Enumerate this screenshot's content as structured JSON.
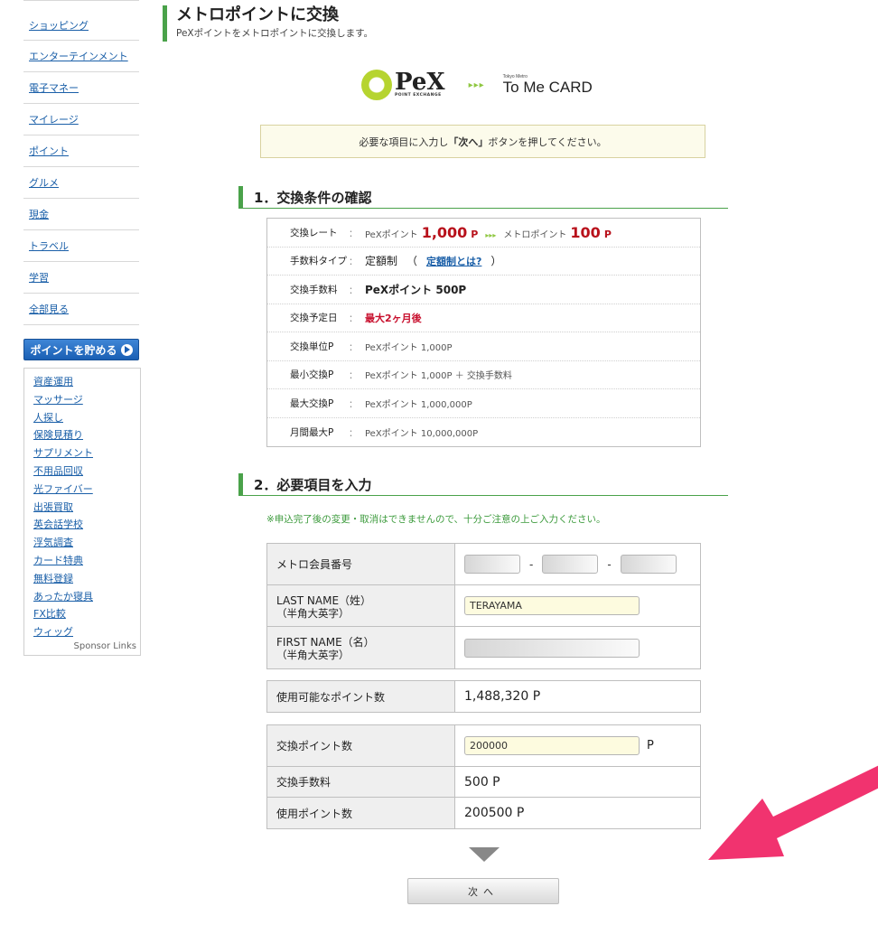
{
  "sidebar": {
    "categories": [
      "ショッピング",
      "エンターテインメント",
      "電子マネー",
      "マイレージ",
      "ポイント",
      "グルメ",
      "現金",
      "トラベル",
      "学習",
      "全部見る"
    ],
    "save_button_label": "ポイントを貯める",
    "sponsor_links": [
      "資産運用",
      "マッサージ",
      "人探し",
      "保険見積り",
      "サプリメント",
      "不用品回収",
      "光ファイバー",
      "出張買取",
      "英会話学校",
      "浮気調査",
      "カード特典",
      "無料登録",
      "あったか寝具",
      "FX比較",
      "ウィッグ"
    ],
    "sponsor_label": "Sponsor Links"
  },
  "header": {
    "title": "メトロポイントに交換",
    "subtitle": "PeXポイントをメトロポイントに交換します。"
  },
  "logos": {
    "pex_text": "PeX",
    "pex_small": "POINT EXCHANGE",
    "arrows": "▸▸▸",
    "tome_top": "Tokyo Metro",
    "tome_main": "To Me CARD"
  },
  "notice": {
    "before": "必要な項目に入力し",
    "emphasis": "「次へ」",
    "after": "ボタンを押してください。"
  },
  "section1": {
    "title": "1．交換条件の確認",
    "colon": "：",
    "rate": {
      "label": "交換レート",
      "pex_label": "PeXポイント",
      "pex_amount": "1,000",
      "pex_unit": "P",
      "arrows": "▸▸▸",
      "metro_label": "メトロポイント",
      "metro_amount": "100",
      "metro_unit": "P"
    },
    "fee_type": {
      "label": "手数料タイプ",
      "value": "定額制",
      "open_paren": "（",
      "link": "定額制とは?",
      "close_paren": "）"
    },
    "fee": {
      "label": "交換手数料",
      "value": "PeXポイント 500P"
    },
    "schedule": {
      "label": "交換予定日",
      "value": "最大2ヶ月後"
    },
    "unit": {
      "label": "交換単位P",
      "value": "PeXポイント 1,000P"
    },
    "min": {
      "label": "最小交換P",
      "value": "PeXポイント 1,000P ＋ 交換手数料"
    },
    "max": {
      "label": "最大交換P",
      "value": "PeXポイント 1,000,000P"
    },
    "monthly": {
      "label": "月間最大P",
      "value": "PeXポイント 10,000,000P"
    }
  },
  "section2": {
    "title": "2．必要項目を入力",
    "caution": "※申込完了後の変更・取消はできませんので、十分ご注意の上ご入力ください。",
    "member_label": "メトロ会員番号",
    "dash": "-",
    "last_name_label": "LAST NAME（姓）",
    "last_name_sub": "（半角大英字）",
    "last_name_value": "TERAYAMA",
    "first_name_label": "FIRST NAME（名）",
    "first_name_sub": "（半角大英字）",
    "available_label": "使用可能なポイント数",
    "available_value": "1,488,320 P",
    "exchange_label": "交換ポイント数",
    "exchange_value": "200000",
    "exchange_unit": "P",
    "fee_label": "交換手数料",
    "fee_value": "500 P",
    "use_label": "使用ポイント数",
    "use_value": "200500 P"
  },
  "next_button_label": "次へ",
  "colors": {
    "accent_green": "#4aa24a",
    "link_blue": "#1a5fa8",
    "red": "#b8111b",
    "arrow_pink": "#f1336f"
  }
}
